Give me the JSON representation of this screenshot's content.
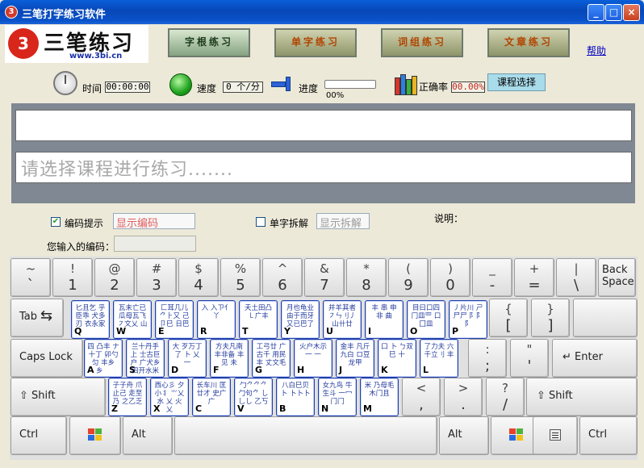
{
  "window": {
    "title": "三笔打字练习软件",
    "icon_text": "3",
    "minimize": "_",
    "maximize": "□",
    "close": "×"
  },
  "logo": {
    "mark": "3",
    "name": "三笔练习",
    "url": "www.3bi.cn"
  },
  "modes": [
    "字根练习",
    "单字练习",
    "词组练习",
    "文章练习"
  ],
  "help_link": "帮助",
  "stats": {
    "time_label": "时间",
    "time_value": "00:00:00",
    "speed_label": "速度",
    "speed_value": "0 个/分",
    "progress_label": "进度",
    "progress_percent": "00%",
    "progress_fraction": 0,
    "accuracy_label": "正确率",
    "accuracy_value": "00.00%"
  },
  "course_button": "课程选择",
  "text_area": {
    "target_line": "",
    "input_placeholder": "请选择课程进行练习......."
  },
  "options": {
    "code_hint_label": "编码提示",
    "code_hint_checked": true,
    "code_hint_box": "显示编码",
    "split_label": "单字拆解",
    "split_checked": false,
    "split_box": "显示拆解",
    "explain_label": "说明：",
    "typed_code_label": "您输入的编码："
  },
  "keyboard": {
    "row1": [
      {
        "top": "~",
        "bot": "`"
      },
      {
        "top": "!",
        "bot": "1"
      },
      {
        "top": "@",
        "bot": "2"
      },
      {
        "top": "#",
        "bot": "3"
      },
      {
        "top": "$",
        "bot": "4"
      },
      {
        "top": "%",
        "bot": "5"
      },
      {
        "top": "^",
        "bot": "6"
      },
      {
        "top": "&",
        "bot": "7"
      },
      {
        "top": "*",
        "bot": "8"
      },
      {
        "top": "(",
        "bot": "9"
      },
      {
        "top": ")",
        "bot": "0"
      },
      {
        "top": "_",
        "bot": "-"
      },
      {
        "top": "+",
        "bot": "="
      },
      {
        "top": "|",
        "bot": "\\"
      }
    ],
    "backspace": "Back\nSpace",
    "tab": "Tab",
    "row2_letters": [
      {
        "letter": "Q",
        "glyphs": "匕且乞 乎臣乖 犬多刃 衣永家"
      },
      {
        "letter": "W",
        "glyphs": "瓦未亡已 瓜母瓦飞 ㇇文乂 山"
      },
      {
        "letter": "E",
        "glyphs": "匚耳几儿 ⺈⺊又 己卩巳 日巴"
      },
      {
        "letter": "R",
        "glyphs": "入 入ㄗ亻丫"
      },
      {
        "letter": "T",
        "glyphs": "夭土田凸 ㇄广丰"
      },
      {
        "letter": "Y",
        "glyphs": "月也龟业 由于而牙 又已巴了"
      },
      {
        "letter": "U",
        "glyphs": "并羊其者 ㇇ㄣ刂丿 山卄廿"
      },
      {
        "letter": "I",
        "glyphs": "丰 串 申 非 曲"
      },
      {
        "letter": "O",
        "glyphs": "目曰口四 冂皿罒 口囗皿"
      },
      {
        "letter": "P",
        "glyphs": "丿片川 ㄕ尸尸 阝阝阝"
      }
    ],
    "row2_punct": [
      {
        "top": "{",
        "bot": "["
      },
      {
        "top": "}",
        "bot": "]"
      }
    ],
    "caps": "Caps Lock",
    "row3_letters": [
      {
        "letter": "A",
        "glyphs": "四 凸丰 ナ十丁 卯勺匀 丰乡",
        "sub": "乡"
      },
      {
        "letter": "S",
        "glyphs": "兰十丹手上 士古巨户 广犬乡 四开水米"
      },
      {
        "letter": "D",
        "glyphs": "大 歹万丁了 卜 乂 一"
      },
      {
        "letter": "F",
        "glyphs": "方夫凡南 丰非备 丰 见 未"
      },
      {
        "letter": "G",
        "glyphs": "工弓廿 广古千 用民丰 丈文毛"
      },
      {
        "letter": "H",
        "glyphs": "火户木示 一 一"
      },
      {
        "letter": "J",
        "glyphs": "金丰 凡斤九白 ロ豆龙甲"
      },
      {
        "letter": "K",
        "glyphs": "口 卜 ㄅ双巳 十"
      },
      {
        "letter": "L",
        "glyphs": "了力夫 六千立刂 丰"
      }
    ],
    "row3_punct": [
      {
        "top": ":",
        "bot": ";"
      },
      {
        "top": "\"",
        "bot": "'"
      }
    ],
    "enter": "Enter",
    "shift_left": "Shift",
    "row4_letters": [
      {
        "letter": "Z",
        "glyphs": "子子舟 爪止己 走至乃 之乙乏"
      },
      {
        "letter": "X",
        "glyphs": "西心彡 夕小丬 ⺌乂水 乂 火 乂"
      },
      {
        "letter": "C",
        "glyphs": "长车川 匡廿才 史广广"
      },
      {
        "letter": "V",
        "glyphs": "勹⺈⺈⺈ 勹句⺈ し乚し 乙丂"
      },
      {
        "letter": "B",
        "glyphs": "八白巳贝 卜 卜卜卜"
      },
      {
        "letter": "N",
        "glyphs": "女九鸟 牛生斗 一冖门门"
      },
      {
        "letter": "M",
        "glyphs": "米 乃母毛 木门且"
      }
    ],
    "row4_punct": [
      {
        "top": "<",
        "bot": ","
      },
      {
        "top": ">",
        "bot": "."
      },
      {
        "top": "?",
        "bot": "/"
      }
    ],
    "shift_right": "Shift",
    "ctrl_left": "Ctrl",
    "alt_left": "Alt",
    "alt_right": "Alt",
    "ctrl_right": "Ctrl"
  },
  "colors": {
    "title_blue": "#0747b8",
    "letter_ink": "#223a9e",
    "hint_red": "#d21b1b",
    "accent_green": "#1ea11e"
  },
  "icons": [
    "app-logo-icon",
    "stopwatch-icon",
    "speed-light-icon",
    "progress-icon",
    "books-icon",
    "windows-logo-icon",
    "menu-key-icon"
  ]
}
